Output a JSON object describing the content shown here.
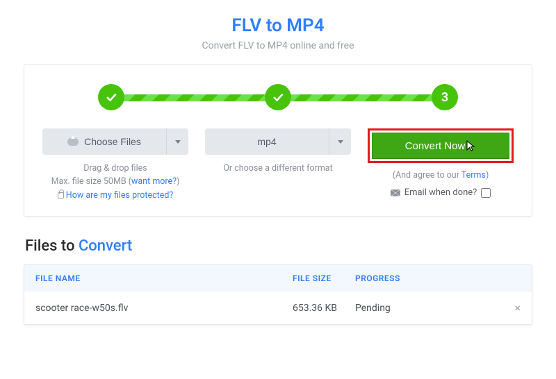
{
  "header": {
    "title": "FLV to MP4",
    "subtitle": "Convert FLV to MP4 online and free"
  },
  "steps": {
    "step1_done": true,
    "step2_done": true,
    "step3_label": "3"
  },
  "choose": {
    "button_label": "Choose Files",
    "hint_line1": "Drag & drop files",
    "hint_line2a": "Max. file size 50MB (",
    "hint_line2_link": "want more?",
    "hint_line2b": ")",
    "protected_link": "How are my files protected?"
  },
  "format": {
    "selected": "mp4",
    "hint": "Or choose a different format"
  },
  "convert": {
    "button_label": "Convert Now",
    "agree_prefix": "(And agree to our ",
    "agree_link": "Terms",
    "agree_suffix": ")",
    "email_label": "Email when done?",
    "email_checked": false
  },
  "files_section": {
    "title_plain": "Files to ",
    "title_accent": "Convert",
    "headers": {
      "name": "FILE NAME",
      "size": "FILE SIZE",
      "progress": "PROGRESS"
    },
    "rows": [
      {
        "name": "scooter race-w50s.flv",
        "size": "653.36 KB",
        "progress": "Pending"
      }
    ]
  }
}
